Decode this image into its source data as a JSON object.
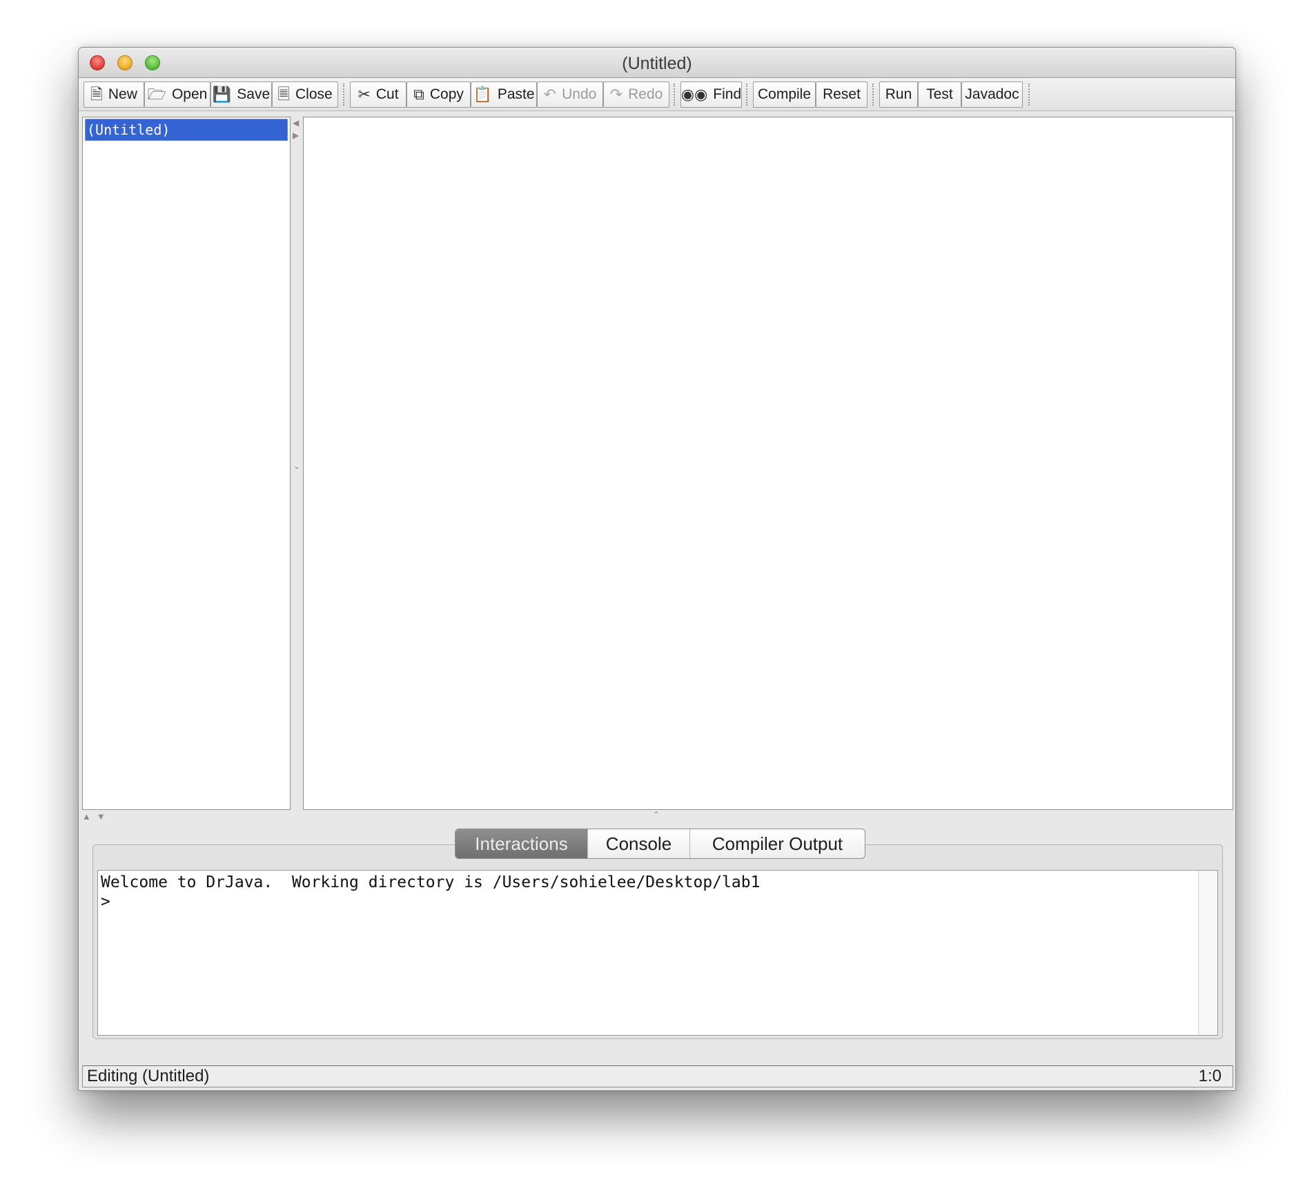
{
  "window": {
    "title": "(Untitled)"
  },
  "toolbar": {
    "new_label": "New",
    "open_label": "Open",
    "save_label": "Save",
    "close_label": "Close",
    "cut_label": "Cut",
    "copy_label": "Copy",
    "paste_label": "Paste",
    "undo_label": "Undo",
    "redo_label": "Redo",
    "find_label": "Find",
    "compile_label": "Compile",
    "reset_label": "Reset",
    "run_label": "Run",
    "test_label": "Test",
    "javadoc_label": "Javadoc",
    "icons": {
      "new": "new-document-icon",
      "open": "open-folder-icon",
      "save": "floppy-disk-icon",
      "close": "close-document-icon",
      "cut": "scissors-icon",
      "copy": "copy-icon",
      "paste": "clipboard-icon",
      "undo": "undo-arrow-icon",
      "redo": "redo-arrow-icon",
      "find": "binoculars-icon"
    },
    "disabled": [
      "Undo",
      "Redo"
    ]
  },
  "documents": {
    "items": [
      {
        "label": "(Untitled)",
        "selected": true
      }
    ]
  },
  "bottom_tabs": {
    "tabs": [
      {
        "label": "Interactions",
        "active": true
      },
      {
        "label": "Console",
        "active": false
      },
      {
        "label": "Compiler Output",
        "active": false
      }
    ]
  },
  "interactions": {
    "welcome": "Welcome to DrJava.  Working directory is /Users/sohielee/Desktop/lab1",
    "prompt": ">"
  },
  "status": {
    "text": "Editing (Untitled)",
    "position": "1:0"
  },
  "colors": {
    "selection": "#3464d4",
    "active_tab": "#7d7d7d"
  }
}
